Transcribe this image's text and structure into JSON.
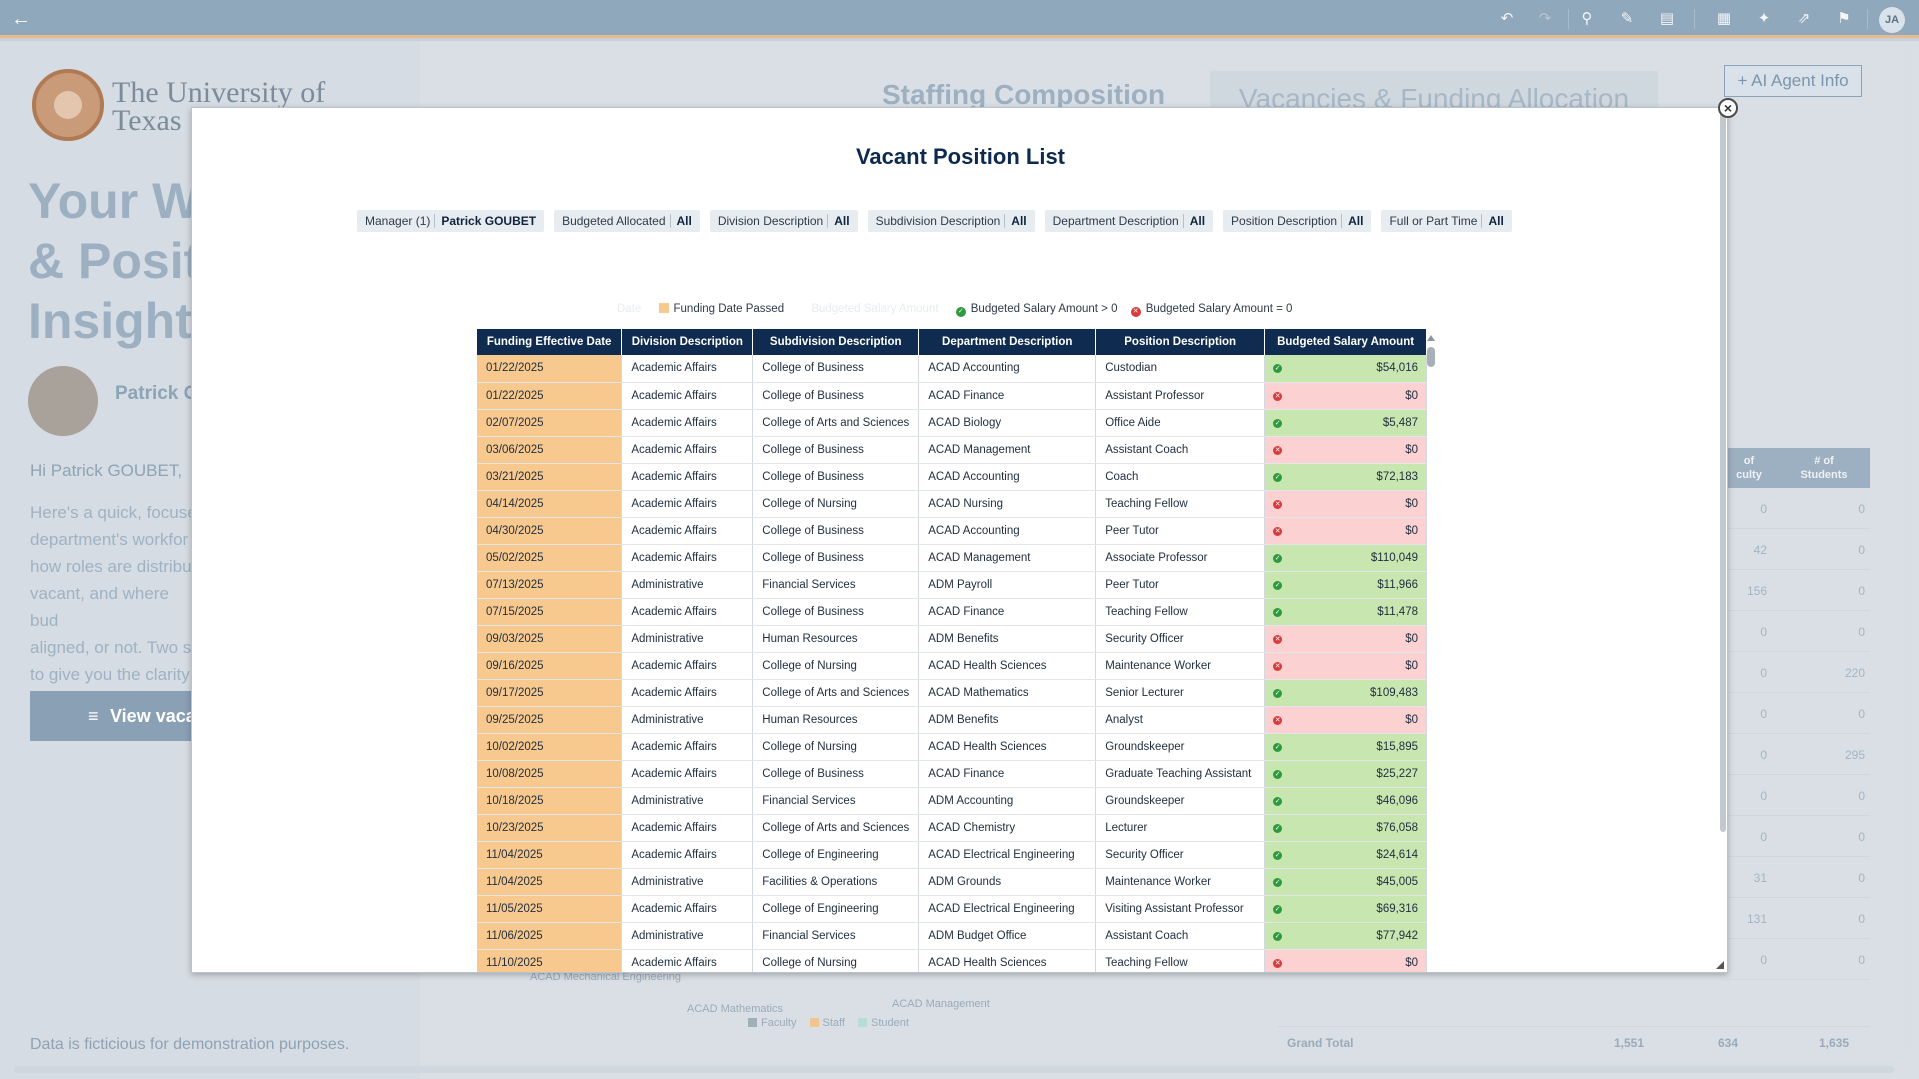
{
  "toolbar": {
    "back_icon": "back-arrow-icon",
    "avatar_initials": "JA"
  },
  "background": {
    "university_name_line1": "The University of",
    "university_name_line2": "Texas",
    "title_line1": "Your W",
    "title_line2": "& Posit",
    "title_line3": "Insights",
    "user_name": "Patrick G",
    "greeting": "Hi Patrick GOUBET,",
    "paragraph": [
      "Here's a quick, focuse",
      "department's workfor",
      "how roles are distribu",
      "vacant, and where bud",
      "aligned, or not. Two s",
      "to give you the clarity"
    ],
    "view_button": "View vaca",
    "footer_note": "Data is ficticious for demonstration purposes.",
    "tab_staffing": "Staffing Composition",
    "tab_vacancies": "Vacancies & Funding Allocation",
    "agent_button": "+ AI Agent Info",
    "right_header_col1": "of\nculty",
    "right_header_col2": "# of\nStudents",
    "right_rows": [
      [
        "0",
        "0"
      ],
      [
        "42",
        "0"
      ],
      [
        "156",
        "0"
      ],
      [
        "0",
        "0"
      ],
      [
        "0",
        "220"
      ],
      [
        "0",
        "0"
      ],
      [
        "0",
        "295"
      ],
      [
        "0",
        "0"
      ],
      [
        "0",
        "0"
      ],
      [
        "31",
        "0"
      ],
      [
        "131",
        "0"
      ],
      [
        "0",
        "0"
      ]
    ],
    "grand_total_label": "Grand Total",
    "grand_total_values": [
      "1,551",
      "634",
      "1,635"
    ],
    "chart_labels": [
      "ACAD Mechanical Engineering",
      "ACAD Mathematics",
      "ACAD Management"
    ],
    "legend": [
      "Faculty",
      "Staff",
      "Student"
    ],
    "legend_colors": [
      "#9fb0b8",
      "#f2c48f",
      "#b8dcd6"
    ]
  },
  "modal": {
    "title": "Vacant Position List",
    "filters": [
      {
        "label": "Manager (1)",
        "value": "Patrick GOUBET"
      },
      {
        "label": "Budgeted Allocated",
        "value": "All"
      },
      {
        "label": "Division Description",
        "value": "All"
      },
      {
        "label": "Subdivision Description",
        "value": "All"
      },
      {
        "label": "Department Description",
        "value": "All"
      },
      {
        "label": "Position Description",
        "value": "All"
      },
      {
        "label": "Full or Part Time",
        "value": "All"
      }
    ],
    "legend": {
      "ghost_date": "Date",
      "funding_passed": "Funding Date Passed",
      "ghost_amount": "Budgeted Salary Amount",
      "positive": "Budgeted Salary Amount > 0",
      "zero": "Budgeted Salary Amount = 0",
      "colors": {
        "funding_passed": "#f8c98e",
        "positive": "#c8e6b0",
        "zero": "#fbd1d1"
      }
    },
    "columns": [
      "Funding Effective Date",
      "Division Description",
      "Subdivision Description",
      "Department Description",
      "Position Description",
      "Budgeted Salary Amount"
    ],
    "rows": [
      [
        "01/22/2025",
        "Academic Affairs",
        "College of Business",
        "ACAD Accounting",
        "Custodian",
        "$54,016"
      ],
      [
        "01/22/2025",
        "Academic Affairs",
        "College of Business",
        "ACAD Finance",
        "Assistant Professor",
        "$0"
      ],
      [
        "02/07/2025",
        "Academic Affairs",
        "College of Arts and Sciences",
        "ACAD Biology",
        "Office Aide",
        "$5,487"
      ],
      [
        "03/06/2025",
        "Academic Affairs",
        "College of Business",
        "ACAD Management",
        "Assistant Coach",
        "$0"
      ],
      [
        "03/21/2025",
        "Academic Affairs",
        "College of Business",
        "ACAD Accounting",
        "Coach",
        "$72,183"
      ],
      [
        "04/14/2025",
        "Academic Affairs",
        "College of Nursing",
        "ACAD Nursing",
        "Teaching Fellow",
        "$0"
      ],
      [
        "04/30/2025",
        "Academic Affairs",
        "College of Business",
        "ACAD Accounting",
        "Peer Tutor",
        "$0"
      ],
      [
        "05/02/2025",
        "Academic Affairs",
        "College of Business",
        "ACAD Management",
        "Associate Professor",
        "$110,049"
      ],
      [
        "07/13/2025",
        "Administrative",
        "Financial Services",
        "ADM Payroll",
        "Peer Tutor",
        "$11,966"
      ],
      [
        "07/15/2025",
        "Academic Affairs",
        "College of Business",
        "ACAD Finance",
        "Teaching Fellow",
        "$11,478"
      ],
      [
        "09/03/2025",
        "Administrative",
        "Human Resources",
        "ADM Benefits",
        "Security Officer",
        "$0"
      ],
      [
        "09/16/2025",
        "Academic Affairs",
        "College of Nursing",
        "ACAD Health Sciences",
        "Maintenance Worker",
        "$0"
      ],
      [
        "09/17/2025",
        "Academic Affairs",
        "College of Arts and Sciences",
        "ACAD Mathematics",
        "Senior Lecturer",
        "$109,483"
      ],
      [
        "09/25/2025",
        "Administrative",
        "Human Resources",
        "ADM Benefits",
        "Analyst",
        "$0"
      ],
      [
        "10/02/2025",
        "Academic Affairs",
        "College of Nursing",
        "ACAD Health Sciences",
        "Groundskeeper",
        "$15,895"
      ],
      [
        "10/08/2025",
        "Academic Affairs",
        "College of Business",
        "ACAD Finance",
        "Graduate Teaching Assistant",
        "$25,227"
      ],
      [
        "10/18/2025",
        "Administrative",
        "Financial Services",
        "ADM Accounting",
        "Groundskeeper",
        "$46,096"
      ],
      [
        "10/23/2025",
        "Academic Affairs",
        "College of Arts and Sciences",
        "ACAD Chemistry",
        "Lecturer",
        "$76,058"
      ],
      [
        "11/04/2025",
        "Academic Affairs",
        "College of Engineering",
        "ACAD Electrical Engineering",
        "Security Officer",
        "$24,614"
      ],
      [
        "11/04/2025",
        "Administrative",
        "Facilities & Operations",
        "ADM Grounds",
        "Maintenance Worker",
        "$45,005"
      ],
      [
        "11/05/2025",
        "Academic Affairs",
        "College of Engineering",
        "ACAD Electrical Engineering",
        "Visiting Assistant Professor",
        "$69,316"
      ],
      [
        "11/06/2025",
        "Administrative",
        "Financial Services",
        "ADM Budget Office",
        "Assistant Coach",
        "$77,942"
      ],
      [
        "11/10/2025",
        "Academic Affairs",
        "College of Nursing",
        "ACAD Health Sciences",
        "Teaching Fellow",
        "$0"
      ]
    ]
  }
}
